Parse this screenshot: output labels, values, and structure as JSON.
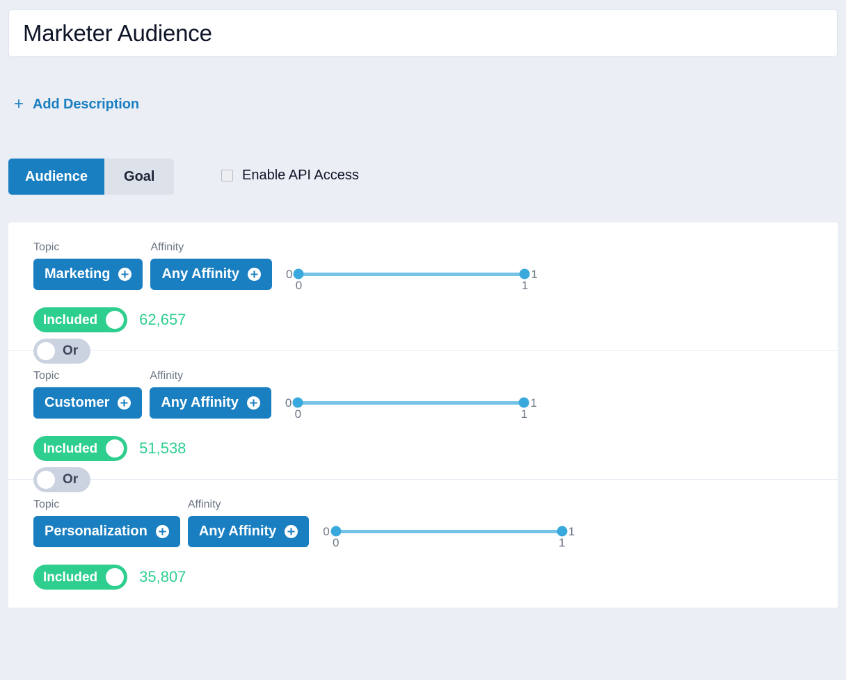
{
  "audience": {
    "title_value": "Marketer Audience",
    "title_placeholder": "Audience name"
  },
  "add_description": {
    "plus": "+",
    "label": "Add Description"
  },
  "tabs": [
    {
      "label": "Audience",
      "active": true
    },
    {
      "label": "Goal",
      "active": false
    }
  ],
  "api_access": {
    "label": "Enable API Access",
    "checked": false
  },
  "labels": {
    "topic": "Topic",
    "affinity": "Affinity",
    "included": "Included",
    "or": "Or"
  },
  "colors": {
    "page_background": "#ebeef5",
    "accent_blue": "#1a7fc1",
    "link_blue": "#1a7fc1",
    "toggle_green": "#2ece8f",
    "toggle_gray": "#ccd3e0",
    "slider_rail": "#76c3e8",
    "slider_handle": "#39a9dd",
    "card_white": "#ffffff",
    "muted_text": "#6d7585"
  },
  "icons": {
    "plus_circle": "plus-circle-icon",
    "plus": "plus-icon"
  },
  "groups": [
    {
      "topic_label": "Topic",
      "topic_value": "Marketing",
      "affinity_label": "Affinity",
      "affinity_value": "Any Affinity",
      "slider": {
        "min_label": "0",
        "max_label": "1",
        "low_value": "0",
        "high_value": "1",
        "low_pct": 0,
        "high_pct": 100
      },
      "included_label": "Included",
      "included_on": true,
      "count": "62,657",
      "or_label": "Or",
      "or_on": false
    },
    {
      "topic_label": "Topic",
      "topic_value": "Customer",
      "affinity_label": "Affinity",
      "affinity_value": "Any Affinity",
      "slider": {
        "min_label": "0",
        "max_label": "1",
        "low_value": "0",
        "high_value": "1",
        "low_pct": 0,
        "high_pct": 100
      },
      "included_label": "Included",
      "included_on": true,
      "count": "51,538",
      "or_label": "Or",
      "or_on": false
    },
    {
      "topic_label": "Topic",
      "topic_value": "Personalization",
      "affinity_label": "Affinity",
      "affinity_value": "Any Affinity",
      "slider": {
        "min_label": "0",
        "max_label": "1",
        "low_value": "0",
        "high_value": "1",
        "low_pct": 0,
        "high_pct": 100
      },
      "included_label": "Included",
      "included_on": true,
      "count": "35,807",
      "or_label": null,
      "or_on": false
    }
  ]
}
